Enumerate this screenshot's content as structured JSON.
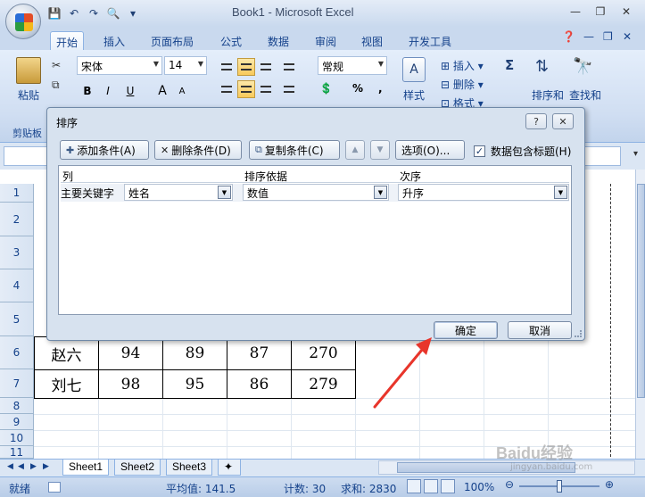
{
  "window": {
    "title": "Book1 - Microsoft Excel"
  },
  "ribbon": {
    "tabs": [
      "开始",
      "插入",
      "页面布局",
      "公式",
      "数据",
      "审阅",
      "视图",
      "开发工具"
    ],
    "paste_label": "粘贴",
    "clipboard_group": "剪贴板",
    "font_name": "宋体",
    "font_size": "14",
    "bold": "B",
    "italic": "I",
    "underline": "U",
    "grow_font": "A",
    "shrink_font": "A",
    "number_format": "常规",
    "percent": "%",
    "comma": ",",
    "styles_label": "样式",
    "cells": {
      "insert": "插入",
      "delete": "删除",
      "format": "格式"
    },
    "sort_filter_label": "排序和",
    "find_select_label": "查找和",
    "sigma": "Σ"
  },
  "sheet": {
    "row_numbers": [
      "1",
      "2",
      "3",
      "4",
      "5",
      "6",
      "7",
      "8",
      "9",
      "10",
      "11"
    ],
    "row6": [
      "赵六",
      "94",
      "89",
      "87",
      "270"
    ],
    "row7": [
      "刘七",
      "98",
      "95",
      "86",
      "279"
    ],
    "tabs": [
      "Sheet1",
      "Sheet2",
      "Sheet3"
    ],
    "active_tab": "Sheet1"
  },
  "status": {
    "ready": "就绪",
    "average": "平均值: 141.5",
    "count": "计数: 30",
    "sum": "求和: 2830",
    "zoom": "100%"
  },
  "sort_dialog": {
    "title": "排序",
    "help": "?",
    "close": "✕",
    "add_condition": "添加条件(A)",
    "delete_condition": "删除条件(D)",
    "copy_condition": "复制条件(C)",
    "options": "选项(O)...",
    "has_headers_label": "数据包含标题(H)",
    "has_headers_checked": true,
    "columns": {
      "col": "列",
      "sort_on": "排序依据",
      "order": "次序"
    },
    "rows": [
      {
        "key_label": "主要关键字",
        "column": "姓名",
        "sort_on": "数值",
        "order": "升序"
      }
    ],
    "ok": "确定",
    "cancel": "取消"
  },
  "watermark": {
    "main": "Baidu经验",
    "sub": "jingyan.baidu.com"
  },
  "colors": {
    "annotation_arrow": "#e8352b",
    "ribbon_blue": "#15428b"
  }
}
